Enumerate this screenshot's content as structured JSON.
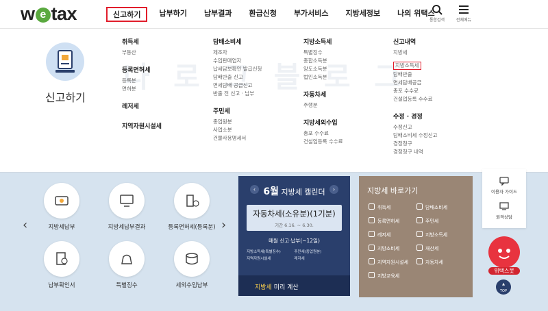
{
  "logo": {
    "text_pre": "w",
    "text_e": "e",
    "text_post": "tax"
  },
  "nav": [
    {
      "label": "신고하기",
      "active": true
    },
    {
      "label": "납부하기"
    },
    {
      "label": "납부결과"
    },
    {
      "label": "환급신청"
    },
    {
      "label": "부가서비스"
    },
    {
      "label": "지방세정보"
    },
    {
      "label": "나의 위택스"
    }
  ],
  "header_icons": {
    "search": "통합검색",
    "menu": "전체메뉴"
  },
  "mega": {
    "watermark": "나 로 그 블 로 그",
    "title": "신고하기",
    "col1": {
      "h1": "취득세",
      "i1": [
        "부동산"
      ],
      "h2": "등록면허세",
      "i2": [
        "등록분",
        "면허분"
      ],
      "h3": "레저세",
      "h4": "지역자원시설세"
    },
    "col2": {
      "h1": "담배소비세",
      "i1": [
        "제조자",
        "수입판매업자",
        "납세담보확인 발급신청",
        "담배반출 신고",
        "면세담배 공급신고",
        "반출 전 신고 · 납부"
      ],
      "h2": "주민세",
      "i2": [
        "종업원분",
        "사업소분",
        "건물사용명세서"
      ]
    },
    "col3": {
      "h1": "지방소득세",
      "i1": [
        "특별징수",
        "종합소득분",
        "양도소득분",
        "법인소득분"
      ],
      "h2": "자동차세",
      "i2": [
        "주행분"
      ],
      "h3": "지방세외수입",
      "i3": [
        "총포 수수료",
        "건설업등록 수수료"
      ]
    },
    "col4": {
      "h1": "신고내역",
      "i1": [
        "지방세",
        "지방소득세",
        "담배반출",
        "면세담배공급",
        "총포 수수료",
        "건설업등록 수수료"
      ],
      "h2": "수정 · 경정",
      "i2": [
        "수정신고",
        "담배소비세 수정신고",
        "경정청구",
        "경정청구 내역"
      ]
    }
  },
  "quick": [
    {
      "label": "지방세납부"
    },
    {
      "label": "지방세납부결과"
    },
    {
      "label": "등록면허세(등록분)"
    },
    {
      "label": "납부확인서"
    },
    {
      "label": "특별징수"
    },
    {
      "label": "세외수입납부"
    }
  ],
  "calendar": {
    "month": "6월",
    "title_suffix": "지방세 캘린더",
    "main": "자동차세(소유분)(1기분)",
    "period": "기간 6.16. ~ 6.30.",
    "monthly": "매월 신고·납부(~12일)",
    "items": [
      "지방소득세(특별징수)",
      "주민세(종업원분)",
      "지역자원시설세",
      "레저세"
    ],
    "footer_y": "지방세",
    "footer_rest": " 미리 계산"
  },
  "shortcut": {
    "title": "지방세 바로가기",
    "items": [
      "취득세",
      "담배소비세",
      "등록면허세",
      "주민세",
      "레저세",
      "지방소득세",
      "지방소비세",
      "재산세",
      "지역자원시설세",
      "자동차세",
      "지방교육세"
    ]
  },
  "rail": {
    "guide": "이용자 가이드",
    "consult": "원격상담"
  },
  "mascot": {
    "label": "위택스봇"
  },
  "top": "TOP",
  "colors": {
    "highlight": "#e11d2b",
    "calendar_bg": "#2a3f6c",
    "shortcut_bg": "#9a8675",
    "page_bg": "#d6e3ef"
  }
}
